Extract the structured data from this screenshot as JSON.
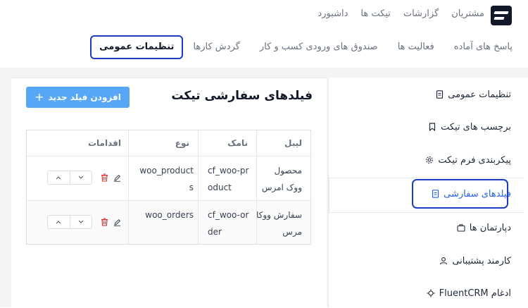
{
  "top_nav": {
    "items": [
      "داشبورد",
      "تیکت ها",
      "گزارشات",
      "مشتریان"
    ]
  },
  "sub_nav": {
    "tabs": [
      "تنظیمات عمومی",
      "گردش کارها",
      "صندوق های ورودی کسب و کار",
      "فعالیت ها",
      "پاسخ های آماده"
    ],
    "active": "تنظیمات عمومی"
  },
  "sidebar": {
    "items": [
      {
        "label": "تنظیمات عمومی",
        "icon": "document-icon"
      },
      {
        "label": "برچسب های تیکت",
        "icon": "bookmark-icon"
      },
      {
        "label": "پیکربندی فرم تیکت",
        "icon": "gear-icon"
      },
      {
        "label": "فیلدهای سفارشی",
        "icon": "document-icon",
        "active": true
      },
      {
        "label": "دپارتمان ها",
        "icon": "briefcase-icon"
      },
      {
        "label": "کارمند پشتیبانی",
        "icon": "user-icon"
      },
      {
        "label": "ادغام FluentCRM",
        "icon": "integration-icon"
      }
    ]
  },
  "main": {
    "title": "فیلدهای سفارشی تیکت",
    "add_button": "افزودن فیلد جدید",
    "table": {
      "headers": [
        "لیبل",
        "نامک",
        "نوع",
        "اقدامات"
      ],
      "rows": [
        {
          "label": "محصول ووک امرس",
          "slug": "cf_woo-product",
          "type": "woo_products"
        },
        {
          "label": "سفارش ووکا مرس",
          "slug": "cf_woo-order",
          "type": "woo_orders"
        }
      ]
    }
  },
  "colors": {
    "accent": "#58a6f6",
    "focus_ring": "#1e3bc4",
    "active_text": "#2563eb",
    "delete": "#dc2626"
  }
}
